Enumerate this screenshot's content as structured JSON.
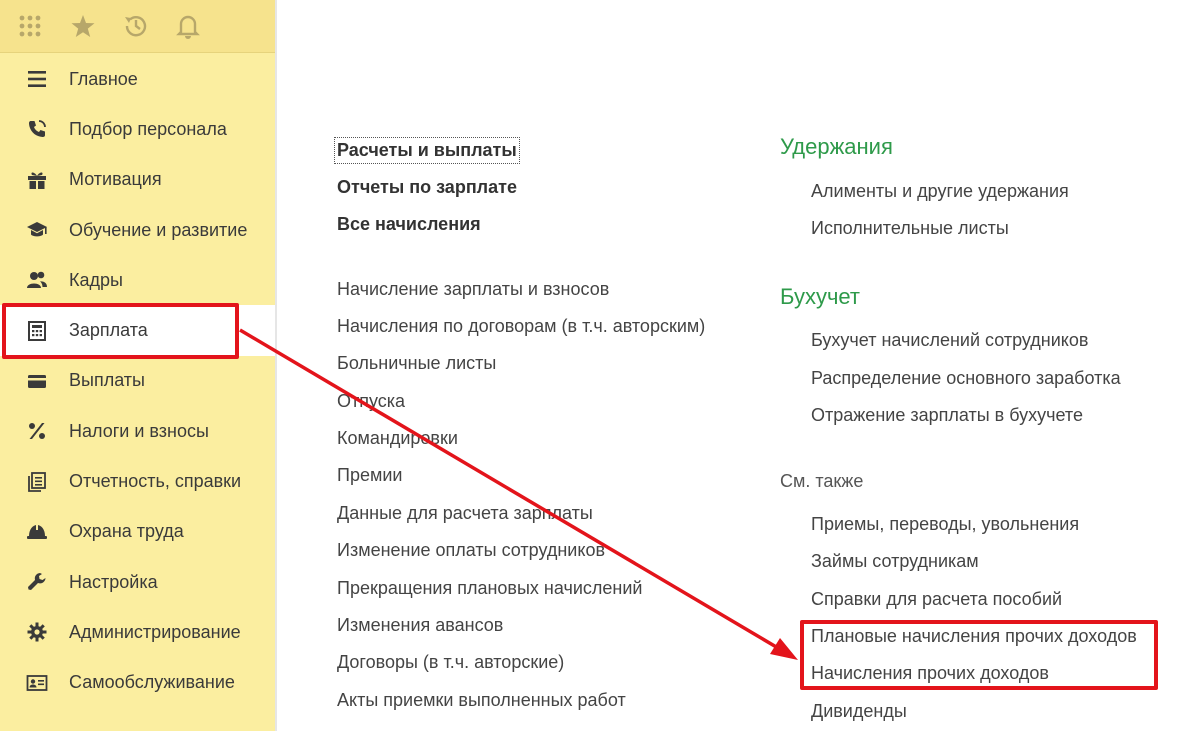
{
  "topbar": {
    "icons": [
      "apps-grid-icon",
      "star-icon",
      "history-icon",
      "bell-icon"
    ]
  },
  "sidebar": {
    "items": [
      {
        "label": "Главное",
        "icon": "menu-lines-icon"
      },
      {
        "label": "Подбор персонала",
        "icon": "phone-icon"
      },
      {
        "label": "Мотивация",
        "icon": "gift-icon"
      },
      {
        "label": "Обучение и развитие",
        "icon": "graduation-cap-icon"
      },
      {
        "label": "Кадры",
        "icon": "people-icon"
      },
      {
        "label": "Зарплата",
        "icon": "calculator-icon"
      },
      {
        "label": "Выплаты",
        "icon": "card-icon"
      },
      {
        "label": "Налоги и взносы",
        "icon": "percent-icon"
      },
      {
        "label": "Отчетность, справки",
        "icon": "reports-icon"
      },
      {
        "label": "Охрана труда",
        "icon": "helmet-icon"
      },
      {
        "label": "Настройка",
        "icon": "wrench-icon"
      },
      {
        "label": "Администрирование",
        "icon": "gear-icon"
      },
      {
        "label": "Самообслуживание",
        "icon": "id-card-icon"
      }
    ],
    "active_index": 5
  },
  "main": {
    "bold_links": [
      "Расчеты и выплаты",
      "Отчеты по зарплате",
      "Все начисления"
    ],
    "links": [
      "Начисление зарплаты и взносов",
      "Начисления по договорам (в т.ч. авторским)",
      "Больничные листы",
      "Отпуска",
      "Командировки",
      "Премии",
      "Данные для расчета зарплаты",
      "Изменение оплаты сотрудников",
      "Прекращения плановых начислений",
      "Изменения авансов",
      "Договоры (в т.ч. авторские)",
      "Акты приемки выполненных работ"
    ],
    "sections": [
      {
        "title": "Удержания",
        "items": [
          "Алименты и другие удержания",
          "Исполнительные листы"
        ]
      },
      {
        "title": "Бухучет",
        "items": [
          "Бухучет начислений сотрудников",
          "Распределение основного заработка",
          "Отражение зарплаты в бухучете"
        ]
      }
    ],
    "see_also": {
      "title": "См. также",
      "items": [
        "Приемы, переводы, увольнения",
        "Займы сотрудникам",
        "Справки для расчета пособий",
        "Плановые начисления прочих доходов",
        "Начисления прочих доходов",
        "Дивиденды"
      ]
    }
  },
  "colors": {
    "sidebar_bg": "#fbeea0",
    "topbar_bg": "#f6e38d",
    "section_title": "#2e9a4a",
    "annotation": "#e3141b"
  }
}
